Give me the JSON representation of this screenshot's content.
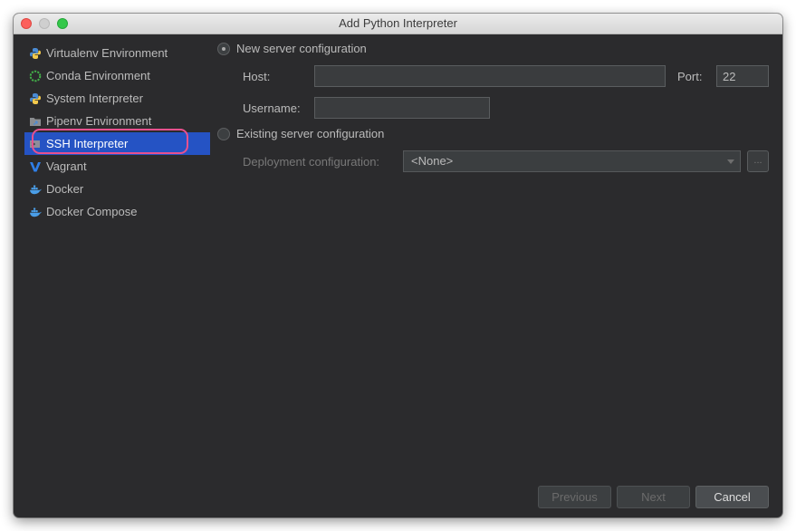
{
  "window": {
    "title": "Add Python Interpreter"
  },
  "sidebar": {
    "items": [
      {
        "label": "Virtualenv Environment",
        "icon": "python-icon"
      },
      {
        "label": "Conda Environment",
        "icon": "conda-icon"
      },
      {
        "label": "System Interpreter",
        "icon": "python-icon"
      },
      {
        "label": "Pipenv Environment",
        "icon": "pipenv-icon"
      },
      {
        "label": "SSH Interpreter",
        "icon": "ssh-icon",
        "selected": true
      },
      {
        "label": "Vagrant",
        "icon": "vagrant-icon"
      },
      {
        "label": "Docker",
        "icon": "docker-icon"
      },
      {
        "label": "Docker Compose",
        "icon": "docker-compose-icon"
      }
    ]
  },
  "form": {
    "new_server_label": "New server configuration",
    "host_label": "Host:",
    "host_value": "",
    "port_label": "Port:",
    "port_value": "22",
    "username_label": "Username:",
    "username_value": "",
    "existing_server_label": "Existing server configuration",
    "deployment_label": "Deployment configuration:",
    "deployment_value": "<None>",
    "browse_label": "..."
  },
  "footer": {
    "previous_label": "Previous",
    "next_label": "Next",
    "cancel_label": "Cancel"
  },
  "colors": {
    "selection": "#2553c4",
    "highlight_ring": "#e8518e",
    "background": "#2b2b2d"
  }
}
